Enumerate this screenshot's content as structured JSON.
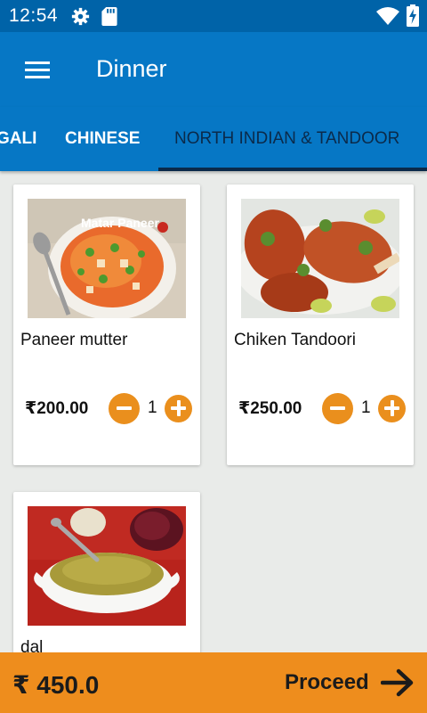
{
  "status_bar": {
    "time": "12:54",
    "icons": [
      "gear-icon",
      "sd-card-icon",
      "wifi-icon",
      "battery-charging-icon"
    ]
  },
  "app_bar": {
    "title": "Dinner",
    "menu_icon": "hamburger-menu-icon"
  },
  "tabs": [
    {
      "label": "GALI",
      "selected": false
    },
    {
      "label": "CHINESE",
      "selected": false
    },
    {
      "label": "NORTH INDIAN & TANDOOR",
      "selected": true
    }
  ],
  "items": [
    {
      "name": "Paneer mutter",
      "price": "₹200.00",
      "quantity": "1",
      "image_watermark": "Matar Paneer"
    },
    {
      "name": "Chiken Tandoori",
      "price": "₹250.00",
      "quantity": "1"
    },
    {
      "name": "dal"
    }
  ],
  "footer": {
    "total": "₹ 450.0",
    "proceed_label": "Proceed",
    "proceed_icon": "arrow-right-icon"
  },
  "colors": {
    "primary": "#0677c5",
    "primary_dark": "#0063a8",
    "accent": "#ee8d1d",
    "tab_selected": "#0b2a4a"
  }
}
